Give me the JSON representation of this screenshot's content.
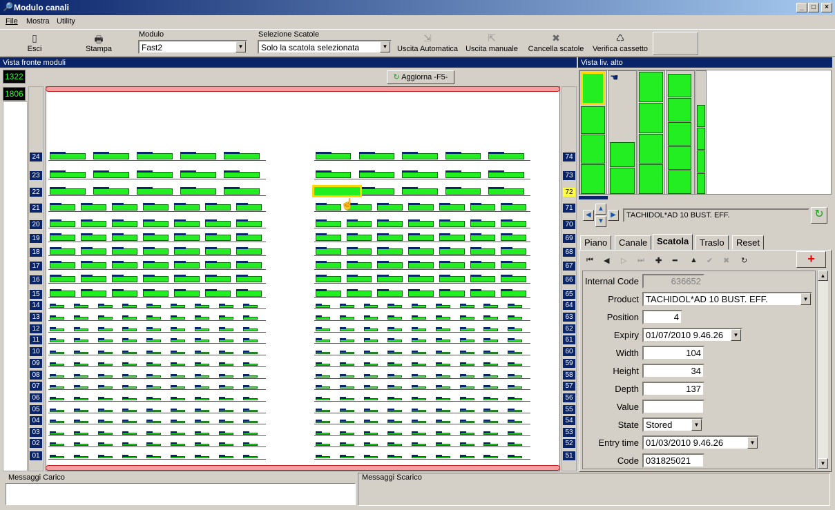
{
  "window": {
    "title": "Modulo canali",
    "min": "_",
    "max": "□",
    "close": "×"
  },
  "menu": [
    "File",
    "Mostra",
    "Utility"
  ],
  "toolbar": {
    "esci": "Esci",
    "stampa": "Stampa",
    "modulo_label": "Modulo",
    "modulo_value": "Fast2",
    "selezione_label": "Selezione Scatole",
    "selezione_value": "Solo la scatola selezionata",
    "uscita_auto": "Uscita Automatica",
    "uscita_manuale": "Uscita manuale",
    "cancella": "Cancella scatole",
    "verifica": "Verifica cassetto"
  },
  "front": {
    "title": "Vista fronte moduli",
    "counter1": "1322",
    "counter2": "1806",
    "refresh": "Aggiorna -F5-",
    "left_rows": [
      "24",
      "23",
      "22",
      "21",
      "20",
      "19",
      "18",
      "17",
      "16",
      "15",
      "14",
      "13",
      "12",
      "11",
      "10",
      "09",
      "08",
      "07",
      "06",
      "05",
      "04",
      "03",
      "02",
      "01"
    ],
    "right_rows": [
      "74",
      "73",
      "72",
      "71",
      "70",
      "69",
      "68",
      "67",
      "66",
      "65",
      "64",
      "63",
      "62",
      "61",
      "60",
      "59",
      "58",
      "57",
      "56",
      "55",
      "54",
      "53",
      "52",
      "51"
    ],
    "highlight_row": "72"
  },
  "top_view": {
    "title": "Vista liv. alto",
    "product": "TACHIDOL*AD 10 BUST. EFF."
  },
  "tabs": [
    "Piano",
    "Canale",
    "Scatola",
    "Traslo",
    "Reset"
  ],
  "active_tab": "Scatola",
  "form": {
    "internal_code_label": "Internal Code",
    "internal_code": "636652",
    "product_label": "Product",
    "product": "TACHIDOL*AD 10 BUST. EFF.",
    "position_label": "Position",
    "position": "4",
    "expiry_label": "Expiry",
    "expiry": "01/07/2010 9.46.26",
    "width_label": "Width",
    "width": "104",
    "height_label": "Height",
    "height": "34",
    "depth_label": "Depth",
    "depth": "137",
    "value_label": "Value",
    "value": "",
    "state_label": "State",
    "state": "Stored",
    "entry_label": "Entry time",
    "entry": "01/03/2010 9.46.26",
    "code_label": "Code",
    "code": "031825021"
  },
  "messages": {
    "carico": "Messaggi Carico",
    "scarico": "Messaggi Scarico"
  }
}
